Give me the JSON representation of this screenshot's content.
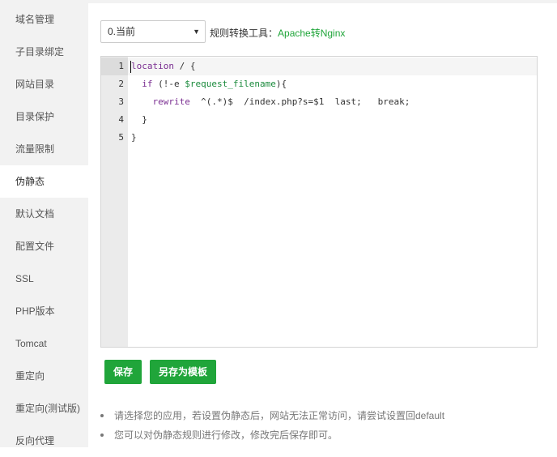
{
  "sidebar": {
    "items": [
      {
        "label": "域名管理"
      },
      {
        "label": "子目录绑定"
      },
      {
        "label": "网站目录"
      },
      {
        "label": "目录保护"
      },
      {
        "label": "流量限制"
      },
      {
        "label": "伪静态",
        "active": true
      },
      {
        "label": "默认文档"
      },
      {
        "label": "配置文件"
      },
      {
        "label": "SSL"
      },
      {
        "label": "PHP版本"
      },
      {
        "label": "Tomcat"
      },
      {
        "label": "重定向"
      },
      {
        "label": "重定向(测试版)"
      },
      {
        "label": "反向代理"
      }
    ]
  },
  "toolbar": {
    "select_value": "0.当前",
    "tool_label": "规则转换工具：",
    "tool_link": "Apache转Nginx"
  },
  "editor": {
    "line_numbers": [
      "1",
      "2",
      "3",
      "4",
      "5"
    ],
    "lines": [
      "location / {",
      "  if (!-e $request_filename){",
      "    rewrite  ^(.*)$  /index.php?s=$1  last;   break;",
      "  }",
      "}"
    ]
  },
  "buttons": {
    "save": "保存",
    "save_as_template": "另存为模板"
  },
  "tips": [
    "请选择您的应用，若设置伪静态后，网站无法正常访问，请尝试设置回default",
    "您可以对伪静态规则进行修改，修改完后保存即可。"
  ],
  "colors": {
    "accent": "#20a53a",
    "sidebar_bg": "#f2f2f2",
    "keyword": "#7a2e91",
    "variable": "#1a8a3c"
  }
}
